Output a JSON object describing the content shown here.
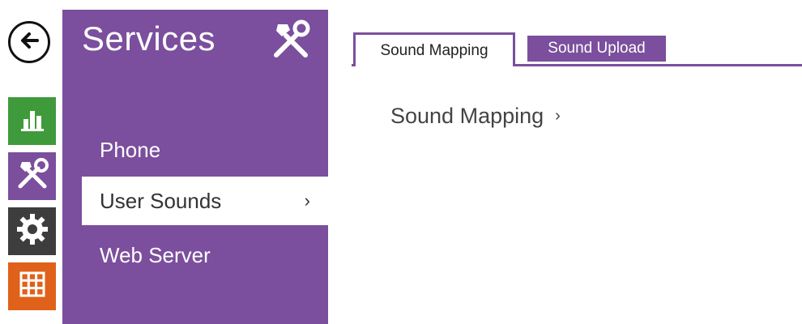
{
  "nav": {
    "back_icon": "arrow-left-icon",
    "items": [
      {
        "id": "status",
        "icon": "bar-chart-icon",
        "color": "#3f9a3b"
      },
      {
        "id": "services",
        "icon": "tools-icon",
        "color": "#7b4f9d"
      },
      {
        "id": "settings",
        "icon": "gear-icon",
        "color": "#3d3d3d"
      },
      {
        "id": "directory",
        "icon": "grid-icon",
        "color": "#e0611a"
      }
    ]
  },
  "menu": {
    "title": "Services",
    "title_icon": "tools-icon",
    "accent_color": "#7b4f9d",
    "items": [
      {
        "label": "Phone"
      },
      {
        "label": "User Sounds",
        "selected": true,
        "chevron": "›"
      },
      {
        "label": "Web Server"
      }
    ]
  },
  "tabs": {
    "items": [
      {
        "label": "Sound Mapping",
        "active": true
      },
      {
        "label": "Sound Upload",
        "active": false
      }
    ]
  },
  "content": {
    "section_link": "Sound Mapping",
    "section_chevron": "›"
  }
}
